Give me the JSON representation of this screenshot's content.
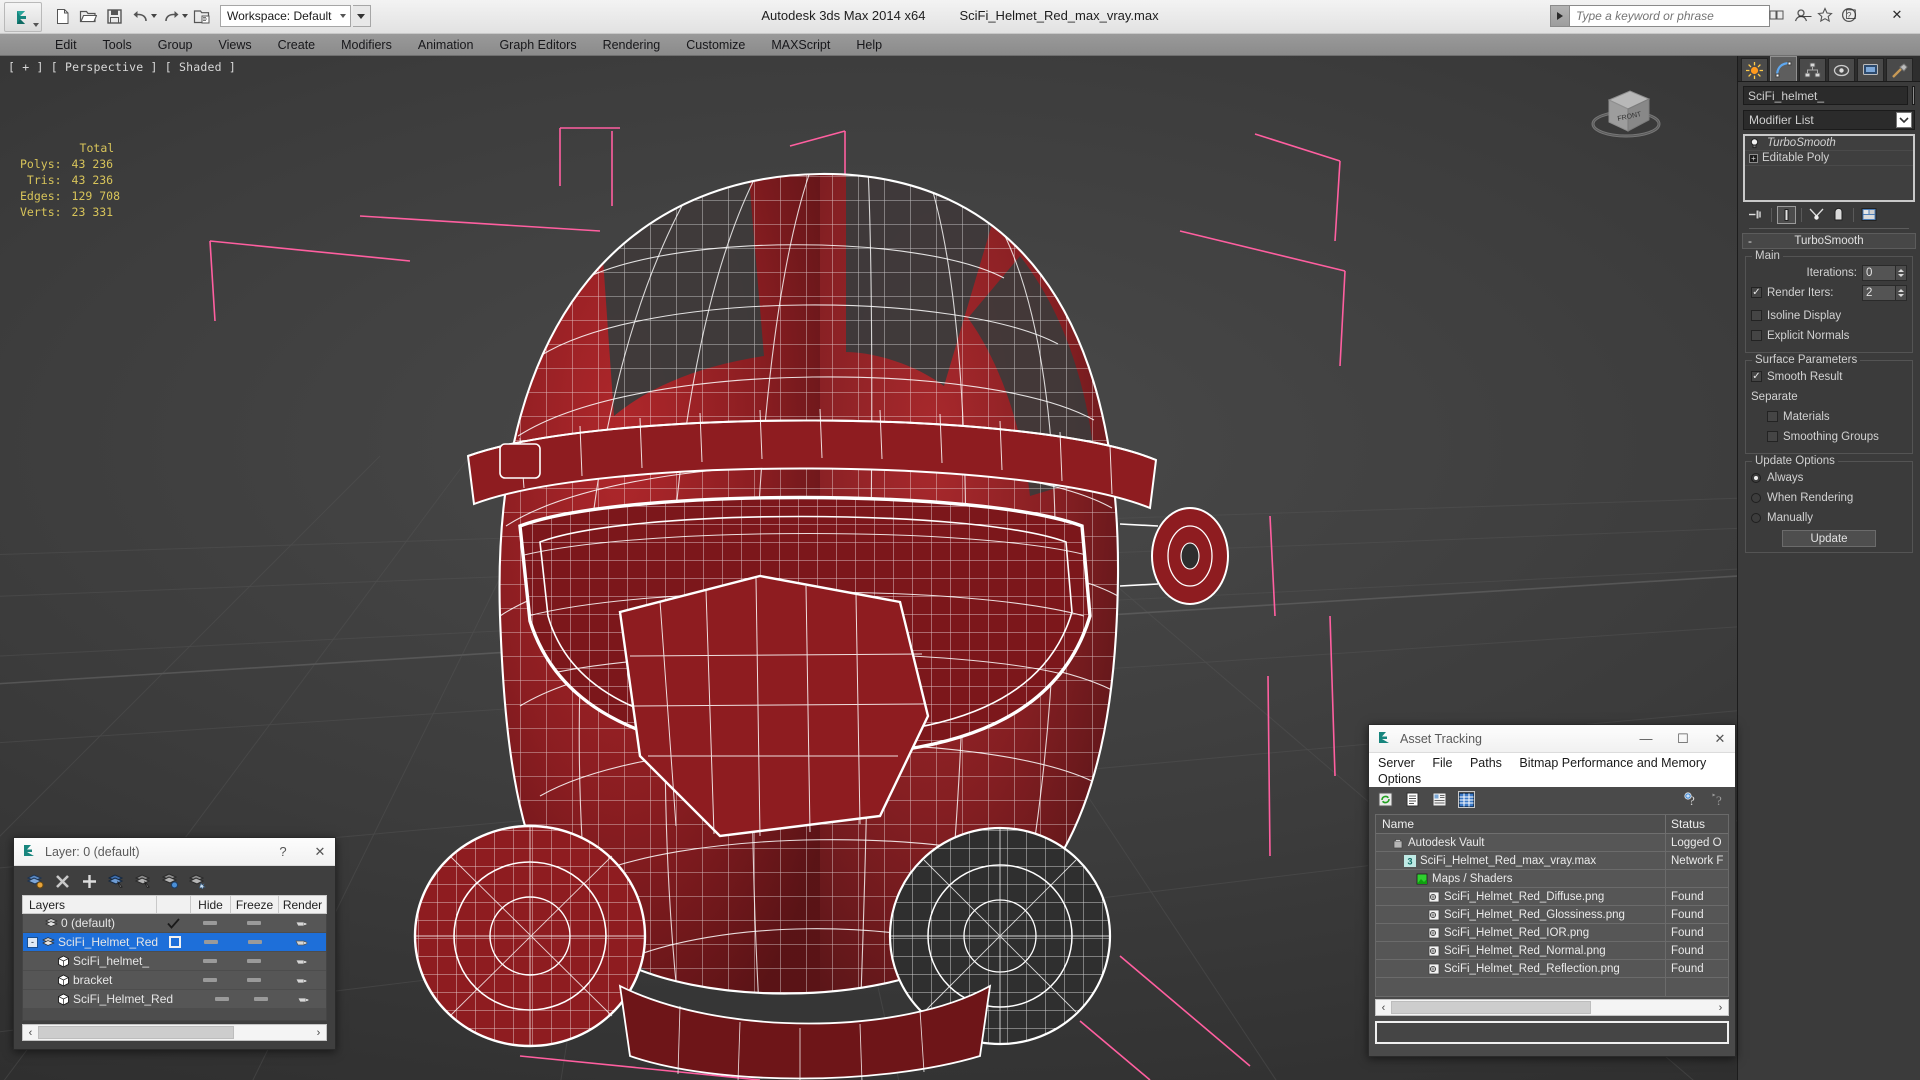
{
  "app": {
    "title": "Autodesk 3ds Max  2014 x64",
    "file": "SciFi_Helmet_Red_max_vray.max",
    "workspace_label": "Workspace: Default"
  },
  "quick_access": {
    "items": [
      {
        "name": "new-icon",
        "label": "New"
      },
      {
        "name": "open-icon",
        "label": "Open"
      },
      {
        "name": "save-icon",
        "label": "Save"
      },
      {
        "name": "undo-icon",
        "label": "Undo"
      },
      {
        "name": "redo-icon",
        "label": "Redo"
      },
      {
        "name": "project-folder-icon",
        "label": "Set Project Folder"
      }
    ]
  },
  "search": {
    "placeholder": "Type a keyword or phrase"
  },
  "window_buttons": {
    "minimize": "—",
    "maximize": "☐",
    "close": "✕"
  },
  "menu": {
    "items": [
      "Edit",
      "Tools",
      "Group",
      "Views",
      "Create",
      "Modifiers",
      "Animation",
      "Graph Editors",
      "Rendering",
      "Customize",
      "MAXScript",
      "Help"
    ]
  },
  "viewport": {
    "label": "[ + ] [ Perspective ] [ Shaded ]",
    "viewcube_face": "FRONT",
    "stats": {
      "column_header": "Total",
      "rows": [
        {
          "label": "Polys:",
          "value": "43 236"
        },
        {
          "label": "Tris:",
          "value": "43 236"
        },
        {
          "label": "Edges:",
          "value": "129 708"
        },
        {
          "label": "Verts:",
          "value": "23 331"
        }
      ]
    },
    "colors": {
      "wireframe": "#ffffff",
      "helmet_red": "#9c1f22",
      "helmet_dark": "#3a3a3a",
      "selection_bracket": "#ff5fa0",
      "grid": "#4e4e4e"
    }
  },
  "command_panel": {
    "tabs": [
      {
        "name": "create-tab",
        "icon": "star-icon"
      },
      {
        "name": "modify-tab",
        "icon": "curve-icon"
      },
      {
        "name": "hierarchy-tab",
        "icon": "hierarchy-icon"
      },
      {
        "name": "motion-tab",
        "icon": "motion-icon"
      },
      {
        "name": "display-tab",
        "icon": "display-icon"
      },
      {
        "name": "utilities-tab",
        "icon": "hammer-icon"
      }
    ],
    "active_tab": 1,
    "object_name": "SciFi_helmet_",
    "modifier_list_label": "Modifier List",
    "stack": [
      {
        "label": "TurboSmooth",
        "italic": true,
        "icon": "bulb-icon"
      },
      {
        "label": "Editable Poly",
        "italic": false,
        "icon": "plus-icon"
      }
    ],
    "stack_tools": [
      {
        "name": "pin-stack-icon"
      },
      {
        "name": "show-end-result-icon"
      },
      {
        "name": "make-unique-icon"
      },
      {
        "name": "remove-modifier-icon"
      },
      {
        "name": "configure-modifier-sets-icon"
      }
    ],
    "rollout": {
      "title": "TurboSmooth",
      "collapse_glyph": "-",
      "main": {
        "title": "Main",
        "iterations_label": "Iterations:",
        "iterations_value": "0",
        "render_iters_label": "Render Iters:",
        "render_iters_value": "2",
        "render_iters_checked": true,
        "isoline_display_label": "Isoline Display",
        "isoline_display_checked": false,
        "explicit_normals_label": "Explicit Normals",
        "explicit_normals_checked": false
      },
      "surface": {
        "title": "Surface Parameters",
        "smooth_result_label": "Smooth Result",
        "smooth_result_checked": true,
        "separate_label": "Separate",
        "materials_label": "Materials",
        "materials_checked": false,
        "smoothing_groups_label": "Smoothing Groups",
        "smoothing_groups_checked": false
      },
      "update": {
        "title": "Update Options",
        "options": [
          {
            "label": "Always",
            "selected": true
          },
          {
            "label": "When Rendering",
            "selected": false
          },
          {
            "label": "Manually",
            "selected": false
          }
        ],
        "button_label": "Update"
      }
    }
  },
  "layer_dialog": {
    "title": "Layer: 0 (default)",
    "help_glyph": "?",
    "close_glyph": "✕",
    "toolbar": [
      {
        "name": "create-new-layer-icon"
      },
      {
        "name": "delete-layer-icon"
      },
      {
        "name": "add-selection-icon"
      },
      {
        "name": "select-objects-in-layer-icon"
      },
      {
        "name": "select-highlighted-objects-icon"
      },
      {
        "name": "highlight-selected-objects-icon"
      },
      {
        "name": "hide-unhide-layers-icon"
      }
    ],
    "columns": [
      "Layers",
      "",
      "Hide",
      "Freeze",
      "Render"
    ],
    "rows": [
      {
        "name": "0 (default)",
        "indent": 0,
        "icon": "layer-icon",
        "active": "check",
        "selected": false,
        "expander": ""
      },
      {
        "name": "SciFi_Helmet_Red",
        "indent": 0,
        "icon": "layer-icon",
        "active": "box",
        "selected": true,
        "expander": "-"
      },
      {
        "name": "SciFi_helmet_",
        "indent": 1,
        "icon": "object-icon",
        "active": "",
        "selected": false,
        "expander": ""
      },
      {
        "name": "bracket",
        "indent": 1,
        "icon": "object-icon",
        "active": "",
        "selected": false,
        "expander": ""
      },
      {
        "name": "SciFi_Helmet_Red",
        "indent": 1,
        "icon": "object-icon",
        "active": "",
        "selected": false,
        "expander": ""
      }
    ]
  },
  "asset_tracking": {
    "title": "Asset Tracking",
    "minimize_glyph": "—",
    "maximize_glyph": "☐",
    "close_glyph": "✕",
    "menu": [
      "Server",
      "File",
      "Paths",
      "Bitmap Performance and Memory",
      "Options"
    ],
    "toolbar": [
      {
        "name": "refresh-icon",
        "selected": false
      },
      {
        "name": "list-view-icon",
        "selected": false
      },
      {
        "name": "detail-view-icon",
        "selected": false
      },
      {
        "name": "grid-view-icon",
        "selected": true
      }
    ],
    "toolbar_right": [
      {
        "name": "help-add-icon"
      },
      {
        "name": "help-icon"
      }
    ],
    "columns": [
      "Name",
      "Status"
    ],
    "rows": [
      {
        "name": "Autodesk Vault",
        "status": "Logged O",
        "indent": 1,
        "icon": "vault-icon"
      },
      {
        "name": "SciFi_Helmet_Red_max_vray.max",
        "status": "Network F",
        "indent": 2,
        "icon": "max-file-icon"
      },
      {
        "name": "Maps / Shaders",
        "status": "",
        "indent": 3,
        "icon": "maps-icon"
      },
      {
        "name": "SciFi_Helmet_Red_Diffuse.png",
        "status": "Found",
        "indent": 4,
        "icon": "bitmap-icon"
      },
      {
        "name": "SciFi_Helmet_Red_Glossiness.png",
        "status": "Found",
        "indent": 4,
        "icon": "bitmap-icon"
      },
      {
        "name": "SciFi_Helmet_Red_IOR.png",
        "status": "Found",
        "indent": 4,
        "icon": "bitmap-icon"
      },
      {
        "name": "SciFi_Helmet_Red_Normal.png",
        "status": "Found",
        "indent": 4,
        "icon": "bitmap-icon"
      },
      {
        "name": "SciFi_Helmet_Red_Reflection.png",
        "status": "Found",
        "indent": 4,
        "icon": "bitmap-icon"
      }
    ],
    "status_text": ""
  }
}
